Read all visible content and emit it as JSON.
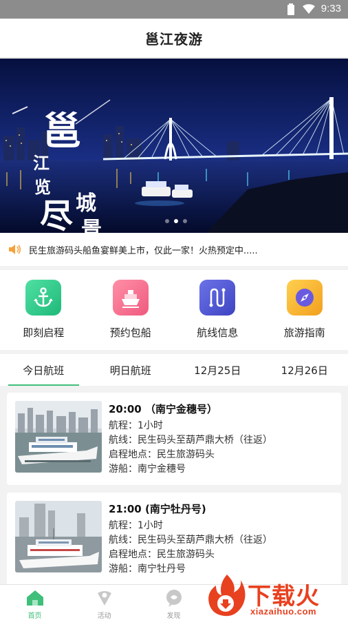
{
  "status_bar": {
    "time": "9:33"
  },
  "app_title": "邕江夜游",
  "banner": {
    "calligraphy_text": "一江览尽邕城景",
    "slide_count": 3,
    "active_slide": 2
  },
  "notice": {
    "text": "民生旅游码头船鱼宴鲜美上市，仅此一家！火热预定中....."
  },
  "quick_menu": [
    {
      "label": "即刻启程",
      "icon": "anchor-icon",
      "color": "#2fcf8e"
    },
    {
      "label": "预约包船",
      "icon": "ship-icon",
      "color": "#f4708f"
    },
    {
      "label": "航线信息",
      "icon": "route-icon",
      "color": "#5b5fd6"
    },
    {
      "label": "旅游指南",
      "icon": "compass-icon",
      "color": "#f7b733"
    }
  ],
  "tabs": [
    {
      "label": "今日航班",
      "active": true
    },
    {
      "label": "明日航班",
      "active": false
    },
    {
      "label": "12月25日",
      "active": false
    },
    {
      "label": "12月26日",
      "active": false
    }
  ],
  "sailings": [
    {
      "title": "20:00 （南宁金穗号）",
      "duration": "航程：1小时",
      "route": "航线：民生码头至葫芦鼎大桥（往返）",
      "departure": "启程地点：民生旅游码头",
      "boat": "游船：南宁金穗号"
    },
    {
      "title": "21:00 (南宁牡丹号)",
      "duration": "航程：1小时",
      "route": "航线：民生码头至葫芦鼎大桥（往返）",
      "departure": "启程地点：民生旅游码头",
      "boat": "游船：南宁牡丹号"
    }
  ],
  "bottom_nav": [
    {
      "label": "首页",
      "icon": "home-icon",
      "active": true
    },
    {
      "label": "活动",
      "icon": "activity-icon",
      "active": false
    },
    {
      "label": "发现",
      "icon": "discover-icon",
      "active": false
    }
  ],
  "watermark": {
    "brand": "下载火",
    "url": "xiazaihuo.com"
  },
  "colors": {
    "accent": "#3fbf7a",
    "statusbar": "#8c8c8c",
    "watermark": "#e8411f"
  }
}
